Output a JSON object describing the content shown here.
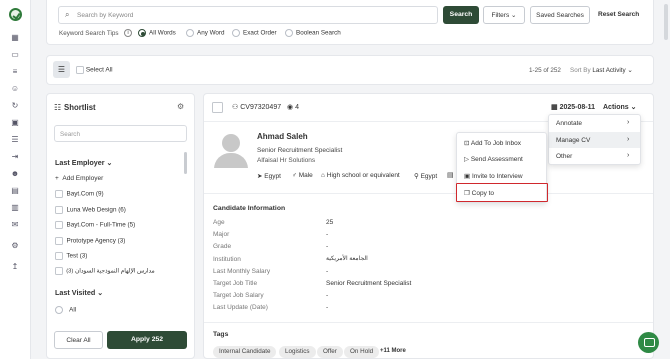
{
  "search": {
    "placeholder": "Search by Keyword",
    "button": "Search",
    "filters": "Filters",
    "saved": "Saved Searches",
    "reset": "Reset Search"
  },
  "tips": {
    "label": "Keyword Search Tips",
    "options": [
      "All Words",
      "Any Word",
      "Exact Order",
      "Boolean Search"
    ],
    "selected": "All Words"
  },
  "toolbar": {
    "select_all": "Select All",
    "count": "1-25 of 252",
    "sort_label": "Sort By",
    "sort_value": "Last Activity"
  },
  "shortlist": {
    "title": "Shortlist",
    "search_placeholder": "Search",
    "employer_title": "Last Employer",
    "add_employer": "Add Employer",
    "employers": [
      "Bayt.Com (9)",
      "Luna Web Design (6)",
      "Bayt.Com - Full-Time (5)",
      "Prototype Agency (3)",
      "Test (3)",
      "مدارس الإلهام النموذجية السودان (3)"
    ],
    "visited_title": "Last Visited",
    "visited_all": "All",
    "clear": "Clear All",
    "apply": "Apply 252"
  },
  "candidate": {
    "id": "CV97320497",
    "views": "4",
    "date": "2025-08-11",
    "actions": "Actions",
    "name": "Ahmad Saleh",
    "title": "Senior Recruitment Specialist",
    "company": "Alfaisal Hr Solutions",
    "location": "Egypt",
    "gender": "Male",
    "education": "High school or equivalent",
    "nationality": "Egypt"
  },
  "info": {
    "heading": "Candidate Information",
    "rows": [
      {
        "label": "Age",
        "value": "25"
      },
      {
        "label": "Major",
        "value": "-"
      },
      {
        "label": "Grade",
        "value": "-"
      },
      {
        "label": "Institution",
        "value": "الجامعة الأمريكية"
      },
      {
        "label": "Last Monthly Salary",
        "value": "-"
      },
      {
        "label": "Target Job Title",
        "value": "Senior Recruitment Specialist"
      },
      {
        "label": "Target Job Salary",
        "value": "-"
      },
      {
        "label": "Last Update (Date)",
        "value": "-"
      }
    ]
  },
  "tags": {
    "heading": "Tags",
    "items": [
      "Internal Candidate",
      "Logistics",
      "Offer",
      "On Hold"
    ],
    "more": "+11 More"
  },
  "actions_menu": {
    "annotate": "Annotate",
    "manage_cv": "Manage CV",
    "other": "Other"
  },
  "submenu": {
    "items": [
      "Add To Job Inbox",
      "Send Assessment",
      "Invite to Interview",
      "Copy to"
    ]
  },
  "colors": {
    "primary": "#2e4b36",
    "highlight_border": "#d0282d",
    "chat": "#2f8a45"
  }
}
